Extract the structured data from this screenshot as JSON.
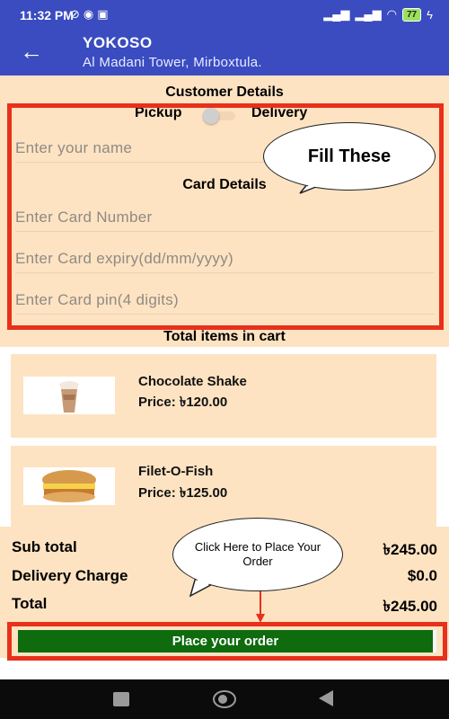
{
  "status_bar": {
    "time": "11:32 PM",
    "notification_icons": [
      "no-sound-icon",
      "messenger-icon",
      "sim-icon"
    ],
    "battery_level": "77",
    "right_icons": [
      "signal-icon",
      "signal-icon",
      "wifi-icon",
      "battery-icon",
      "charging-icon"
    ]
  },
  "app_bar": {
    "back_icon": "arrow-left-icon",
    "title": "YOKOSO",
    "subtitle": "Al Madani Tower, Mirboxtula."
  },
  "customer": {
    "heading": "Customer Details",
    "pickup_label": "Pickup",
    "delivery_label": "Delivery",
    "name_placeholder": "Enter your name",
    "card_heading": "Card Details",
    "card_number_placeholder": "Enter Card Number",
    "card_expiry_placeholder": "Enter Card expiry(dd/mm/yyyy)",
    "card_pin_placeholder": "Enter Card pin(4 digits)"
  },
  "callouts": {
    "fill": "Fill These",
    "order": "Click Here to Place Your Order"
  },
  "cart": {
    "heading": "Total items in cart",
    "items": [
      {
        "name": "Chocolate Shake",
        "price": "Price: ৳120.00"
      },
      {
        "name": "Filet-O-Fish",
        "price": "Price: ৳125.00"
      }
    ]
  },
  "totals": {
    "subtotal_label": "Sub total",
    "subtotal_value": "৳245.00",
    "delivery_label": "Delivery Charge",
    "delivery_value": "$0.0",
    "total_label": "Total",
    "total_value": "৳245.00"
  },
  "order_button": "Place your order",
  "colors": {
    "app_bar": "#3a4cc0",
    "panel": "#fde3c2",
    "highlight": "#e8301b",
    "order_button": "#0e6b0e"
  }
}
